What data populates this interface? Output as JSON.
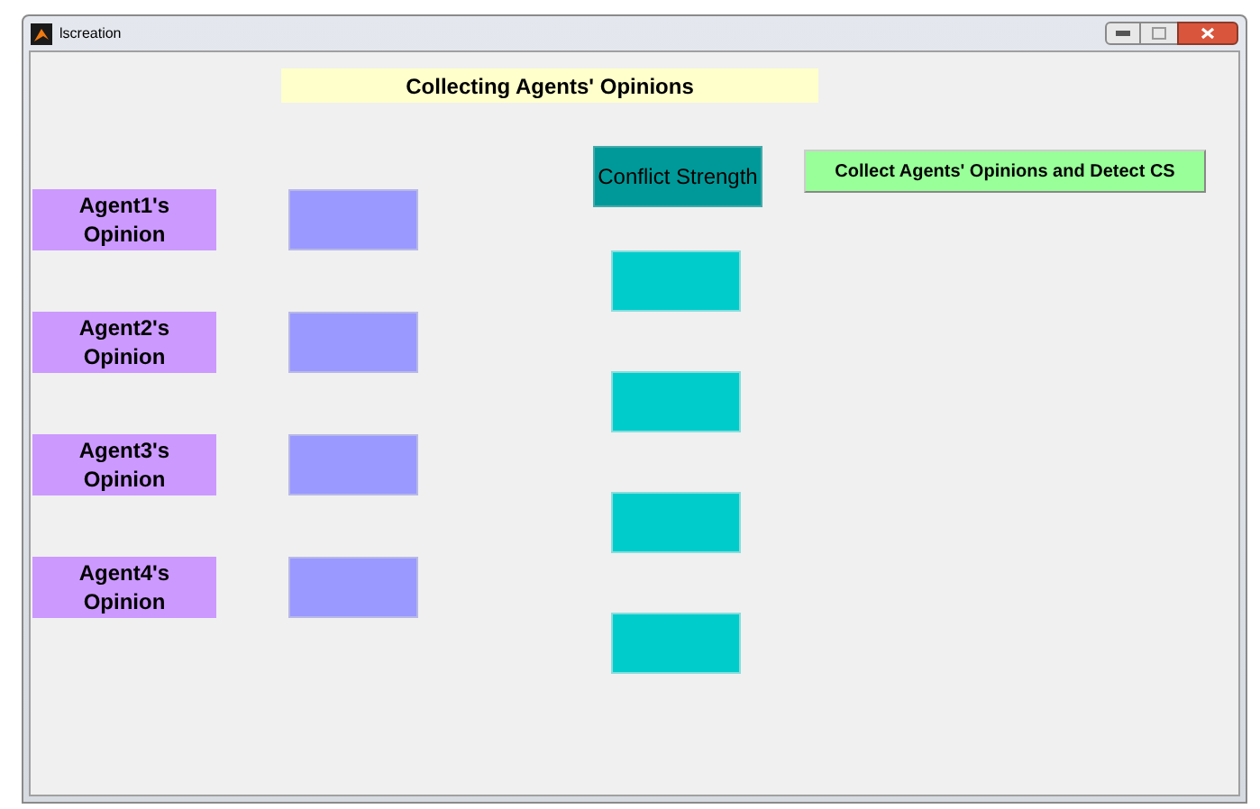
{
  "window": {
    "title": "lscreation"
  },
  "heading": "Collecting Agents' Opinions",
  "agents": [
    {
      "label": "Agent1's Opinion"
    },
    {
      "label": "Agent2's Opinion"
    },
    {
      "label": "Agent3's Opinion"
    },
    {
      "label": "Agent4's Opinion"
    }
  ],
  "conflict_strength": {
    "header": "Conflict Strength"
  },
  "button": "Collect Agents' Opinions and Detect CS"
}
